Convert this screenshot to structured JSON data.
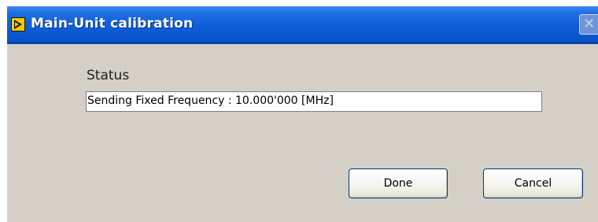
{
  "window": {
    "title": "Main-Unit calibration",
    "icon": "labview-run-icon",
    "close_glyph": "✕"
  },
  "status": {
    "label": "Status",
    "value": "Sending Fixed Frequency : 10.000'000 [MHz]"
  },
  "buttons": {
    "done_label": "Done",
    "cancel_label": "Cancel"
  },
  "colors": {
    "titlebar": "#0a57cf",
    "dialog_background": "#d4d0c8",
    "button_border": "#003c74"
  }
}
